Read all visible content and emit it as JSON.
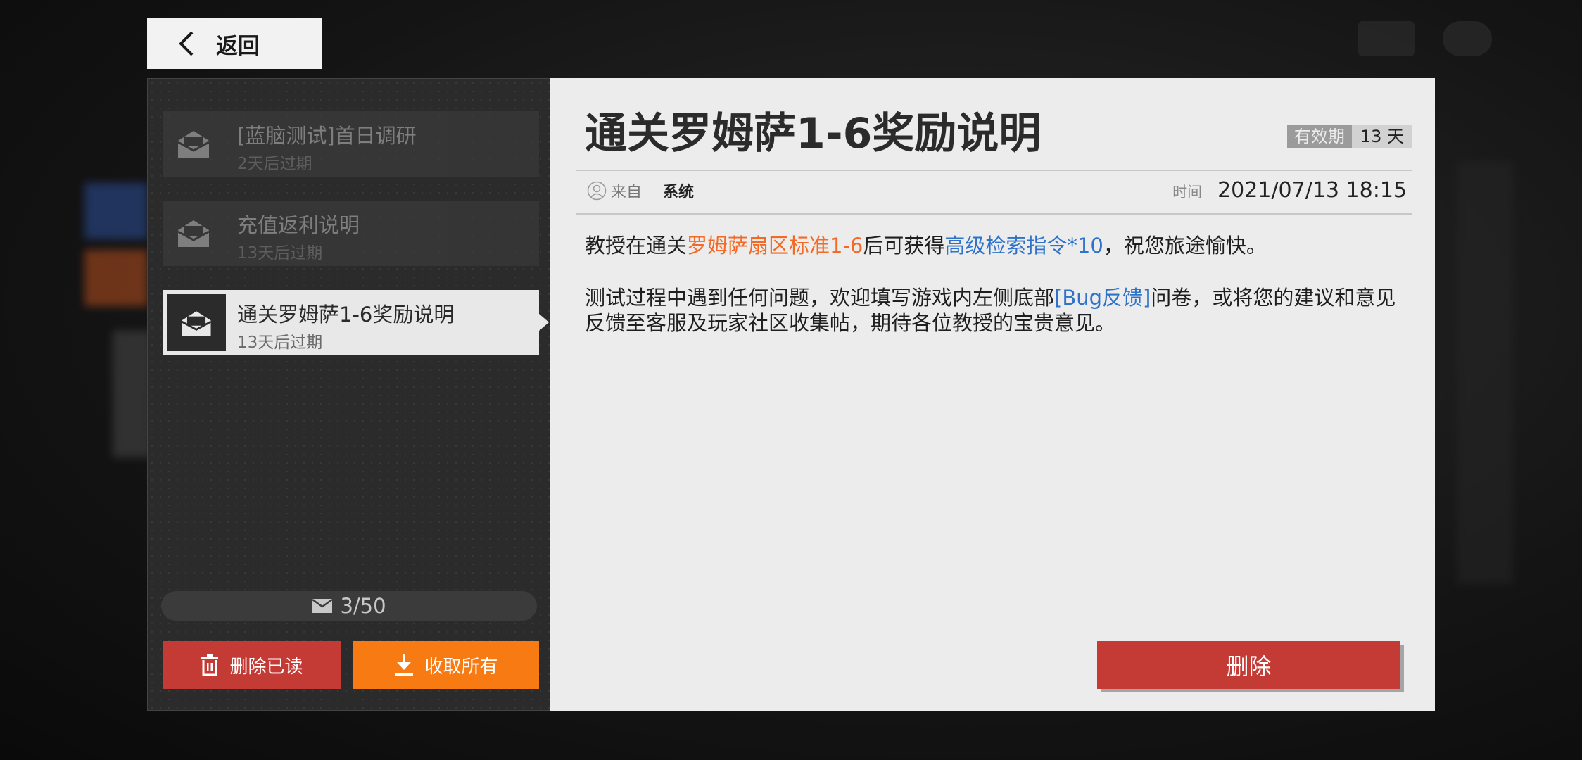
{
  "colors": {
    "accent_red": "#c43a35",
    "accent_orange": "#f77b12",
    "highlight_orange": "#f26a26",
    "highlight_blue": "#2e73c9"
  },
  "header": {
    "back_label": "返回"
  },
  "mail_list": {
    "items": [
      {
        "title": "[蓝脑测试]首日调研",
        "expire": "2天后过期"
      },
      {
        "title": "充值返利说明",
        "expire": "13天后过期"
      },
      {
        "title": "通关罗姆萨1-6奖励说明",
        "expire": "13天后过期"
      }
    ],
    "selected_index": 2,
    "count": "3/50",
    "delete_read_label": "删除已读",
    "collect_all_label": "收取所有"
  },
  "detail": {
    "title": "通关罗姆萨1-6奖励说明",
    "validity_label": "有效期",
    "validity_value": "13 天",
    "from_label": "来自",
    "sender": "系统",
    "time_label": "时间",
    "time_value": "2021/07/13 18:15",
    "p1": {
      "a": "教授在通关",
      "b": "罗姆萨扇区标准1-6",
      "c": "后可获得",
      "d": "高级检索指令*10",
      "e": "，祝您旅途愉快。"
    },
    "p2": {
      "a": "测试过程中遇到任何问题，欢迎填写游戏内左侧底部",
      "b": "[Bug反馈]",
      "c": "问卷，或将您的建议和意见反馈至客服及玩家社区收集帖，期待各位教授的宝贵意见。"
    },
    "delete_label": "删除"
  }
}
